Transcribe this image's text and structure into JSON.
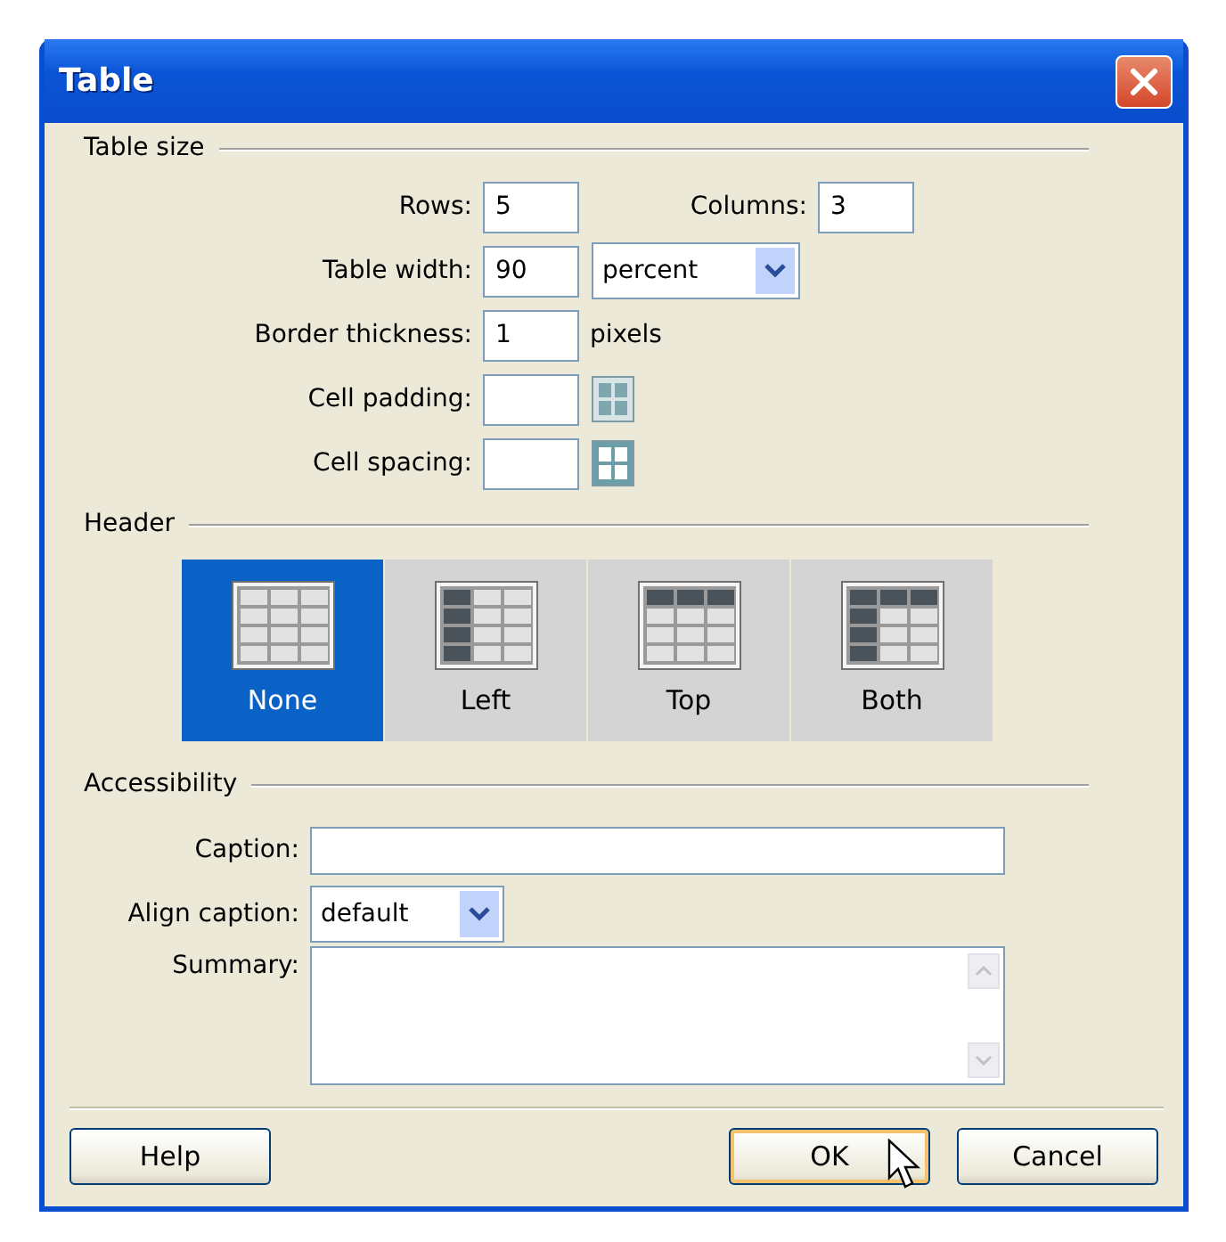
{
  "window": {
    "title": "Table"
  },
  "table_size": {
    "heading": "Table size",
    "rows": {
      "label": "Rows:",
      "value": "5"
    },
    "columns": {
      "label": "Columns:",
      "value": "3"
    },
    "table_width": {
      "label": "Table width:",
      "value": "90",
      "unit": "percent"
    },
    "border_thickness": {
      "label": "Border thickness:",
      "value": "1",
      "unit": "pixels"
    },
    "cell_padding": {
      "label": "Cell padding:"
    },
    "cell_spacing": {
      "label": "Cell spacing:"
    }
  },
  "header": {
    "heading": "Header",
    "options": [
      {
        "label": "None",
        "kind": "none",
        "selected": true
      },
      {
        "label": "Left",
        "kind": "left",
        "selected": false
      },
      {
        "label": "Top",
        "kind": "top",
        "selected": false
      },
      {
        "label": "Both",
        "kind": "both",
        "selected": false
      }
    ]
  },
  "accessibility": {
    "heading": "Accessibility",
    "caption": {
      "label": "Caption:"
    },
    "align_caption": {
      "label": "Align caption:",
      "value": "default"
    },
    "summary": {
      "label": "Summary:"
    }
  },
  "buttons": [
    {
      "label": "Help",
      "default": false
    },
    {
      "label": "OK",
      "default": true
    },
    {
      "label": "Cancel",
      "default": false
    }
  ]
}
